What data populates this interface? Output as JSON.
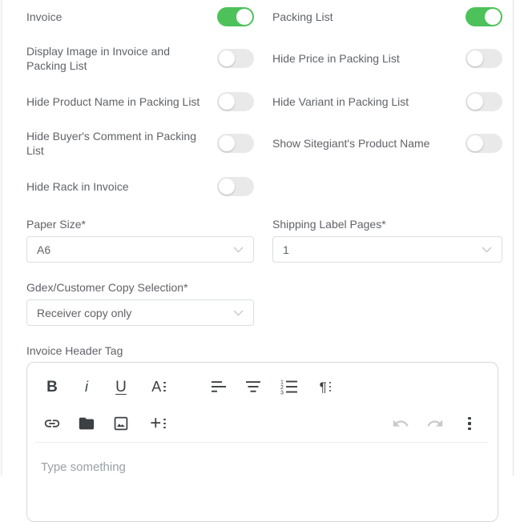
{
  "colors": {
    "toggle_on": "#4dc25a",
    "toggle_off": "#e9e9e9",
    "label_text": "#5f6368",
    "select_border": "#dadde3"
  },
  "toggles": {
    "left": [
      {
        "label": "Invoice",
        "state": "on"
      },
      {
        "label": "Display Image in Invoice and Packing List",
        "state": "off"
      },
      {
        "label": "Hide Product Name in Packing List",
        "state": "off"
      },
      {
        "label": "Hide Buyer's Comment in Packing List",
        "state": "off"
      },
      {
        "label": "Hide Rack in Invoice",
        "state": "off"
      }
    ],
    "right": [
      {
        "label": "Packing List",
        "state": "on"
      },
      {
        "label": "Hide Price in Packing List",
        "state": "off"
      },
      {
        "label": "Hide Variant in Packing List",
        "state": "off"
      },
      {
        "label": "Show Sitegiant's Product Name",
        "state": "off"
      }
    ]
  },
  "fields": {
    "paper_size": {
      "label": "Paper Size*",
      "value": "A6"
    },
    "shipping_label_pages": {
      "label": "Shipping Label Pages*",
      "value": "1"
    },
    "gdex_copy": {
      "label": "Gdex/Customer Copy Selection*",
      "value": "Receiver copy only"
    }
  },
  "editor": {
    "label": "Invoice Header Tag",
    "placeholder": "Type something",
    "toolbar": {
      "bold_glyph": "B",
      "italic_glyph": "i",
      "underline_glyph": "U",
      "font_glyph": "A",
      "paragraph_glyph": "¶",
      "add_glyph": "+",
      "row1_icons": [
        "bold",
        "italic",
        "underline",
        "font-dropdown",
        "align-left",
        "align-center",
        "ordered-list",
        "paragraph-dropdown"
      ],
      "row2_icons": [
        "link",
        "folder",
        "insert-image",
        "add-more",
        "undo",
        "redo",
        "more-vertical"
      ]
    }
  }
}
